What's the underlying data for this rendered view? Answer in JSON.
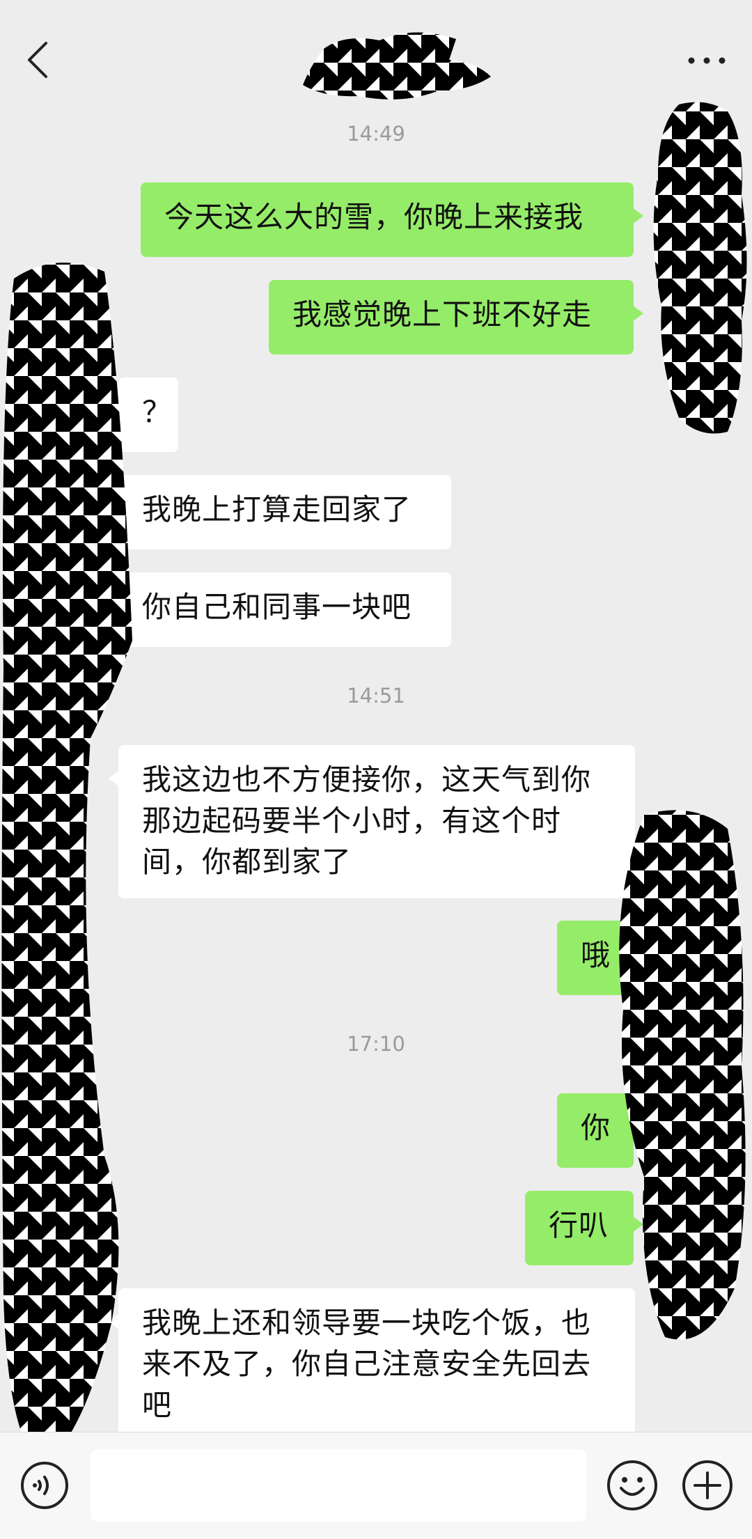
{
  "header": {
    "title": ""
  },
  "messages": [
    {
      "type": "time",
      "text": "14:49"
    },
    {
      "type": "msg",
      "side": "me",
      "text": "今天这么大的雪，你晚上来接我"
    },
    {
      "type": "msg",
      "side": "me",
      "text": "我感觉晚上下班不好走"
    },
    {
      "type": "msg",
      "side": "them",
      "text": "？"
    },
    {
      "type": "msg",
      "side": "them",
      "text": "我晚上打算走回家了"
    },
    {
      "type": "msg",
      "side": "them",
      "text": "你自己和同事一块吧"
    },
    {
      "type": "time",
      "text": "14:51"
    },
    {
      "type": "msg",
      "side": "them",
      "lines": [
        "我这边也不方便接你，这天气到你",
        "那边起码要半个小时，有这个时",
        "间，你都到家了"
      ]
    },
    {
      "type": "msg",
      "side": "me",
      "text": "哦"
    },
    {
      "type": "time",
      "text": "17:10"
    },
    {
      "type": "msg",
      "side": "me",
      "text": "你"
    },
    {
      "type": "msg",
      "side": "me",
      "text": "行叭"
    },
    {
      "type": "msg",
      "side": "them",
      "lines": [
        "我晚上还和领导要一块吃个饭，也",
        "来不及了，你自己注意安全先回去",
        "吧"
      ]
    }
  ],
  "input": {
    "value": "",
    "placeholder": ""
  },
  "icons": {
    "back": "chevron-left-icon",
    "more": "more-dots-icon",
    "voice": "voice-icon",
    "emoji": "emoji-icon",
    "plus": "plus-icon"
  },
  "colors": {
    "bg": "#ededed",
    "me_bubble": "#95ec69",
    "them_bubble": "#ffffff",
    "time_text": "#9a9a9a"
  }
}
